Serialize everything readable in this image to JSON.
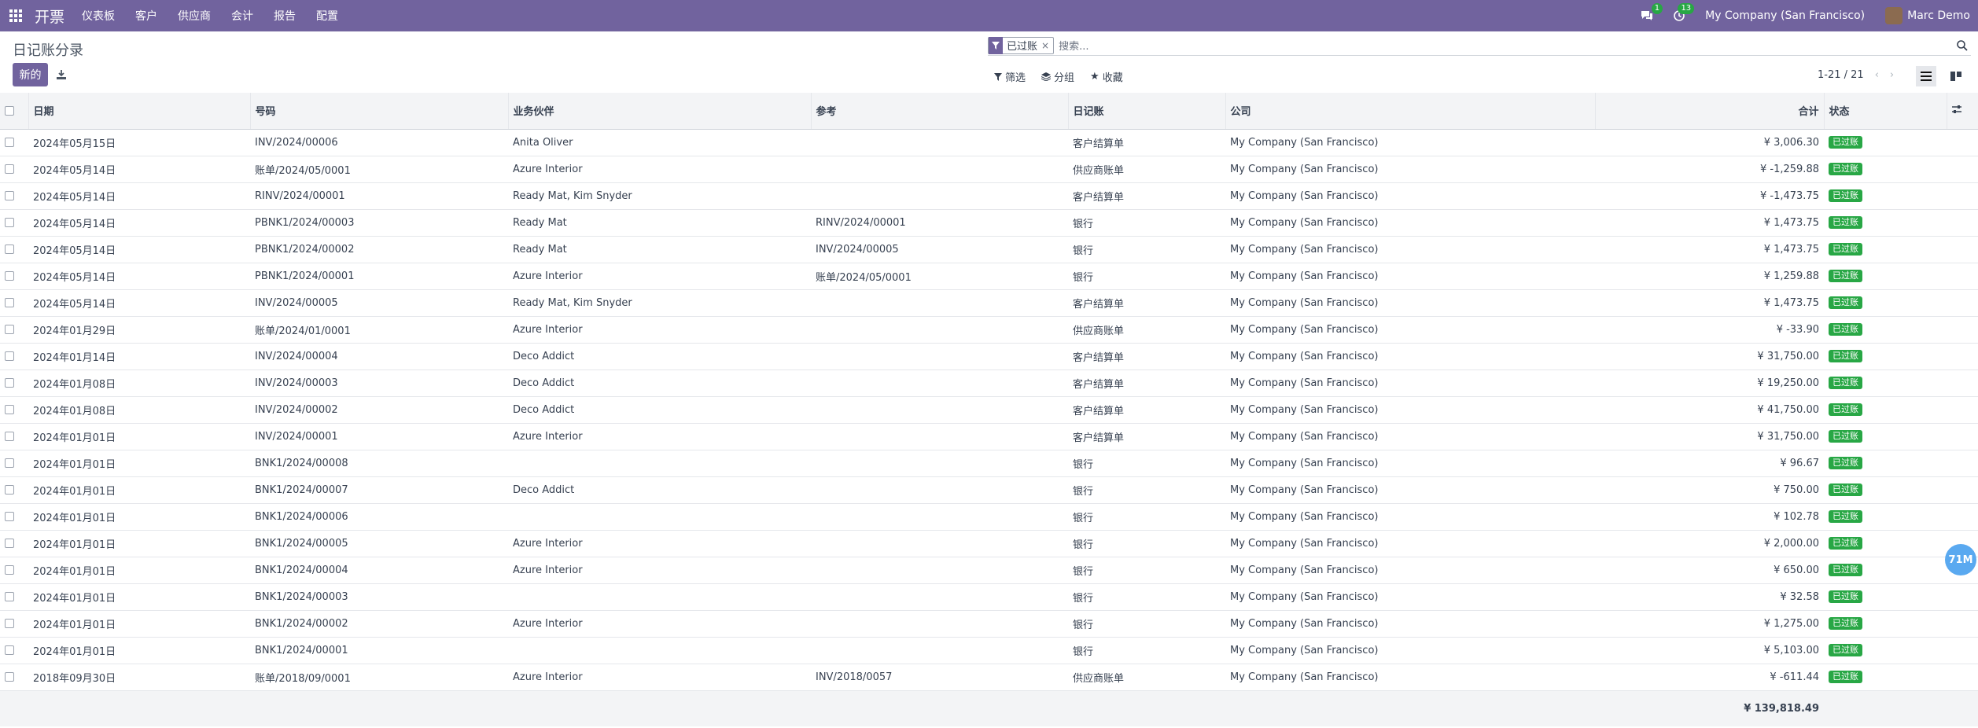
{
  "topbar": {
    "app_icon": "grid-icon",
    "brand": "开票",
    "menu": [
      "仪表板",
      "客户",
      "供应商",
      "会计",
      "报告",
      "配置"
    ],
    "chat_badge": "1",
    "activity_badge": "13",
    "company": "My Company (San Francisco)",
    "user": "Marc Demo"
  },
  "control": {
    "title": "日记账分录",
    "new_label": "新的",
    "facet_label": "已过账",
    "search_placeholder": "搜索...",
    "filter_label": "筛选",
    "group_label": "分组",
    "fav_label": "收藏",
    "pager": "1-21 / 21"
  },
  "table": {
    "headers": {
      "date": "日期",
      "number": "号码",
      "partner": "业务伙伴",
      "ref": "参考",
      "journal": "日记账",
      "company": "公司",
      "total": "合计",
      "state": "状态"
    },
    "rows": [
      {
        "date": "2024年05月15日",
        "number": "INV/2024/00006",
        "partner": "Anita Oliver",
        "ref": "",
        "journal": "客户结算单",
        "company": "My Company (San Francisco)",
        "total": "¥ 3,006.30",
        "state": "已过账"
      },
      {
        "date": "2024年05月14日",
        "number": "账单/2024/05/0001",
        "partner": "Azure Interior",
        "ref": "",
        "journal": "供应商账单",
        "company": "My Company (San Francisco)",
        "total": "¥ -1,259.88",
        "state": "已过账"
      },
      {
        "date": "2024年05月14日",
        "number": "RINV/2024/00001",
        "partner": "Ready Mat, Kim Snyder",
        "ref": "",
        "journal": "客户结算单",
        "company": "My Company (San Francisco)",
        "total": "¥ -1,473.75",
        "state": "已过账"
      },
      {
        "date": "2024年05月14日",
        "number": "PBNK1/2024/00003",
        "partner": "Ready Mat",
        "ref": "RINV/2024/00001",
        "journal": "银行",
        "company": "My Company (San Francisco)",
        "total": "¥ 1,473.75",
        "state": "已过账"
      },
      {
        "date": "2024年05月14日",
        "number": "PBNK1/2024/00002",
        "partner": "Ready Mat",
        "ref": "INV/2024/00005",
        "journal": "银行",
        "company": "My Company (San Francisco)",
        "total": "¥ 1,473.75",
        "state": "已过账"
      },
      {
        "date": "2024年05月14日",
        "number": "PBNK1/2024/00001",
        "partner": "Azure Interior",
        "ref": "账单/2024/05/0001",
        "journal": "银行",
        "company": "My Company (San Francisco)",
        "total": "¥ 1,259.88",
        "state": "已过账"
      },
      {
        "date": "2024年05月14日",
        "number": "INV/2024/00005",
        "partner": "Ready Mat, Kim Snyder",
        "ref": "",
        "journal": "客户结算单",
        "company": "My Company (San Francisco)",
        "total": "¥ 1,473.75",
        "state": "已过账"
      },
      {
        "date": "2024年01月29日",
        "number": "账单/2024/01/0001",
        "partner": "Azure Interior",
        "ref": "",
        "journal": "供应商账单",
        "company": "My Company (San Francisco)",
        "total": "¥ -33.90",
        "state": "已过账"
      },
      {
        "date": "2024年01月14日",
        "number": "INV/2024/00004",
        "partner": "Deco Addict",
        "ref": "",
        "journal": "客户结算单",
        "company": "My Company (San Francisco)",
        "total": "¥ 31,750.00",
        "state": "已过账"
      },
      {
        "date": "2024年01月08日",
        "number": "INV/2024/00003",
        "partner": "Deco Addict",
        "ref": "",
        "journal": "客户结算单",
        "company": "My Company (San Francisco)",
        "total": "¥ 19,250.00",
        "state": "已过账"
      },
      {
        "date": "2024年01月08日",
        "number": "INV/2024/00002",
        "partner": "Deco Addict",
        "ref": "",
        "journal": "客户结算单",
        "company": "My Company (San Francisco)",
        "total": "¥ 41,750.00",
        "state": "已过账"
      },
      {
        "date": "2024年01月01日",
        "number": "INV/2024/00001",
        "partner": "Azure Interior",
        "ref": "",
        "journal": "客户结算单",
        "company": "My Company (San Francisco)",
        "total": "¥ 31,750.00",
        "state": "已过账"
      },
      {
        "date": "2024年01月01日",
        "number": "BNK1/2024/00008",
        "partner": "",
        "ref": "",
        "journal": "银行",
        "company": "My Company (San Francisco)",
        "total": "¥ 96.67",
        "state": "已过账"
      },
      {
        "date": "2024年01月01日",
        "number": "BNK1/2024/00007",
        "partner": "Deco Addict",
        "ref": "",
        "journal": "银行",
        "company": "My Company (San Francisco)",
        "total": "¥ 750.00",
        "state": "已过账"
      },
      {
        "date": "2024年01月01日",
        "number": "BNK1/2024/00006",
        "partner": "",
        "ref": "",
        "journal": "银行",
        "company": "My Company (San Francisco)",
        "total": "¥ 102.78",
        "state": "已过账"
      },
      {
        "date": "2024年01月01日",
        "number": "BNK1/2024/00005",
        "partner": "Azure Interior",
        "ref": "",
        "journal": "银行",
        "company": "My Company (San Francisco)",
        "total": "¥ 2,000.00",
        "state": "已过账"
      },
      {
        "date": "2024年01月01日",
        "number": "BNK1/2024/00004",
        "partner": "Azure Interior",
        "ref": "",
        "journal": "银行",
        "company": "My Company (San Francisco)",
        "total": "¥ 650.00",
        "state": "已过账"
      },
      {
        "date": "2024年01月01日",
        "number": "BNK1/2024/00003",
        "partner": "",
        "ref": "",
        "journal": "银行",
        "company": "My Company (San Francisco)",
        "total": "¥ 32.58",
        "state": "已过账"
      },
      {
        "date": "2024年01月01日",
        "number": "BNK1/2024/00002",
        "partner": "Azure Interior",
        "ref": "",
        "journal": "银行",
        "company": "My Company (San Francisco)",
        "total": "¥ 1,275.00",
        "state": "已过账"
      },
      {
        "date": "2024年01月01日",
        "number": "BNK1/2024/00001",
        "partner": "",
        "ref": "",
        "journal": "银行",
        "company": "My Company (San Francisco)",
        "total": "¥ 5,103.00",
        "state": "已过账"
      },
      {
        "date": "2018年09月30日",
        "number": "账单/2018/09/0001",
        "partner": "Azure Interior",
        "ref": "INV/2018/0057",
        "journal": "供应商账单",
        "company": "My Company (San Francisco)",
        "total": "¥ -611.44",
        "state": "已过账"
      }
    ],
    "footer_total": "¥ 139,818.49"
  },
  "fab": "71M",
  "colors": {
    "brand": "#71639e",
    "state_green": "#28a745"
  }
}
